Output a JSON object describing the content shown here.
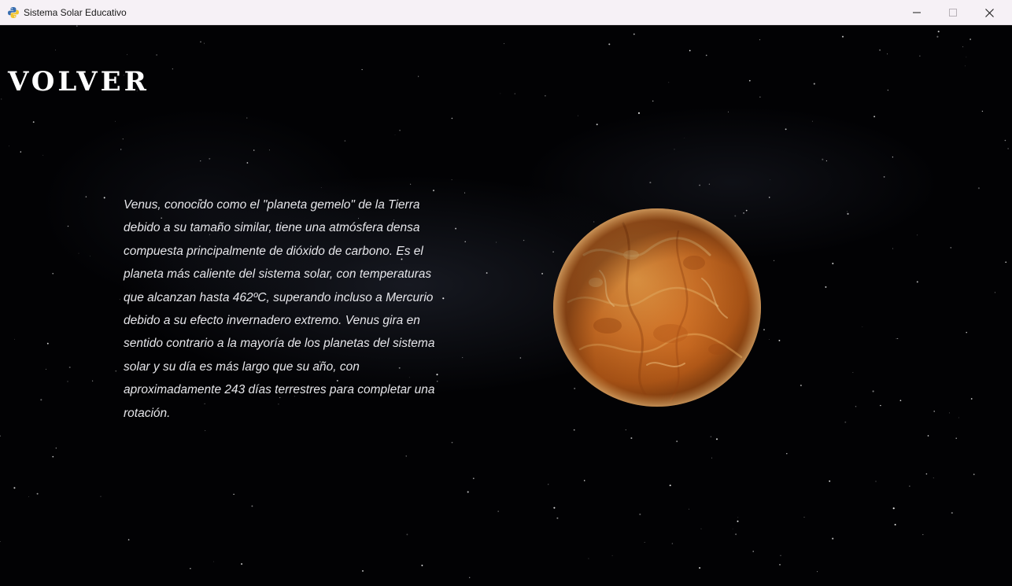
{
  "window": {
    "title": "Sistema Solar Educativo",
    "app_icon": "python-icon",
    "controls": {
      "minimize_icon": "minimize-icon",
      "maximize_icon": "maximize-icon",
      "close_icon": "close-icon"
    }
  },
  "page": {
    "back_label": "VOLVER",
    "description": "Venus, conocido como el \"planeta gemelo\" de la Tierra debido a su tamaño similar, tiene una atmósfera densa compuesta principalmente de dióxido de carbono. Es el planeta más caliente del sistema solar, con temperaturas que alcanzan hasta 462ºC, superando incluso a Mercurio debido a su efecto invernadero extremo. Venus gira en sentido contrario a la mayoría de los planetas del sistema solar y su día es más largo que su año, con aproximadamente 243 días terrestres para completar una rotación.",
    "planet_image": "venus-planet"
  },
  "colors": {
    "background": "#020204",
    "text": "#e6e6ea",
    "planet_base": "#d8782a",
    "titlebar": "#f6f1f6"
  }
}
